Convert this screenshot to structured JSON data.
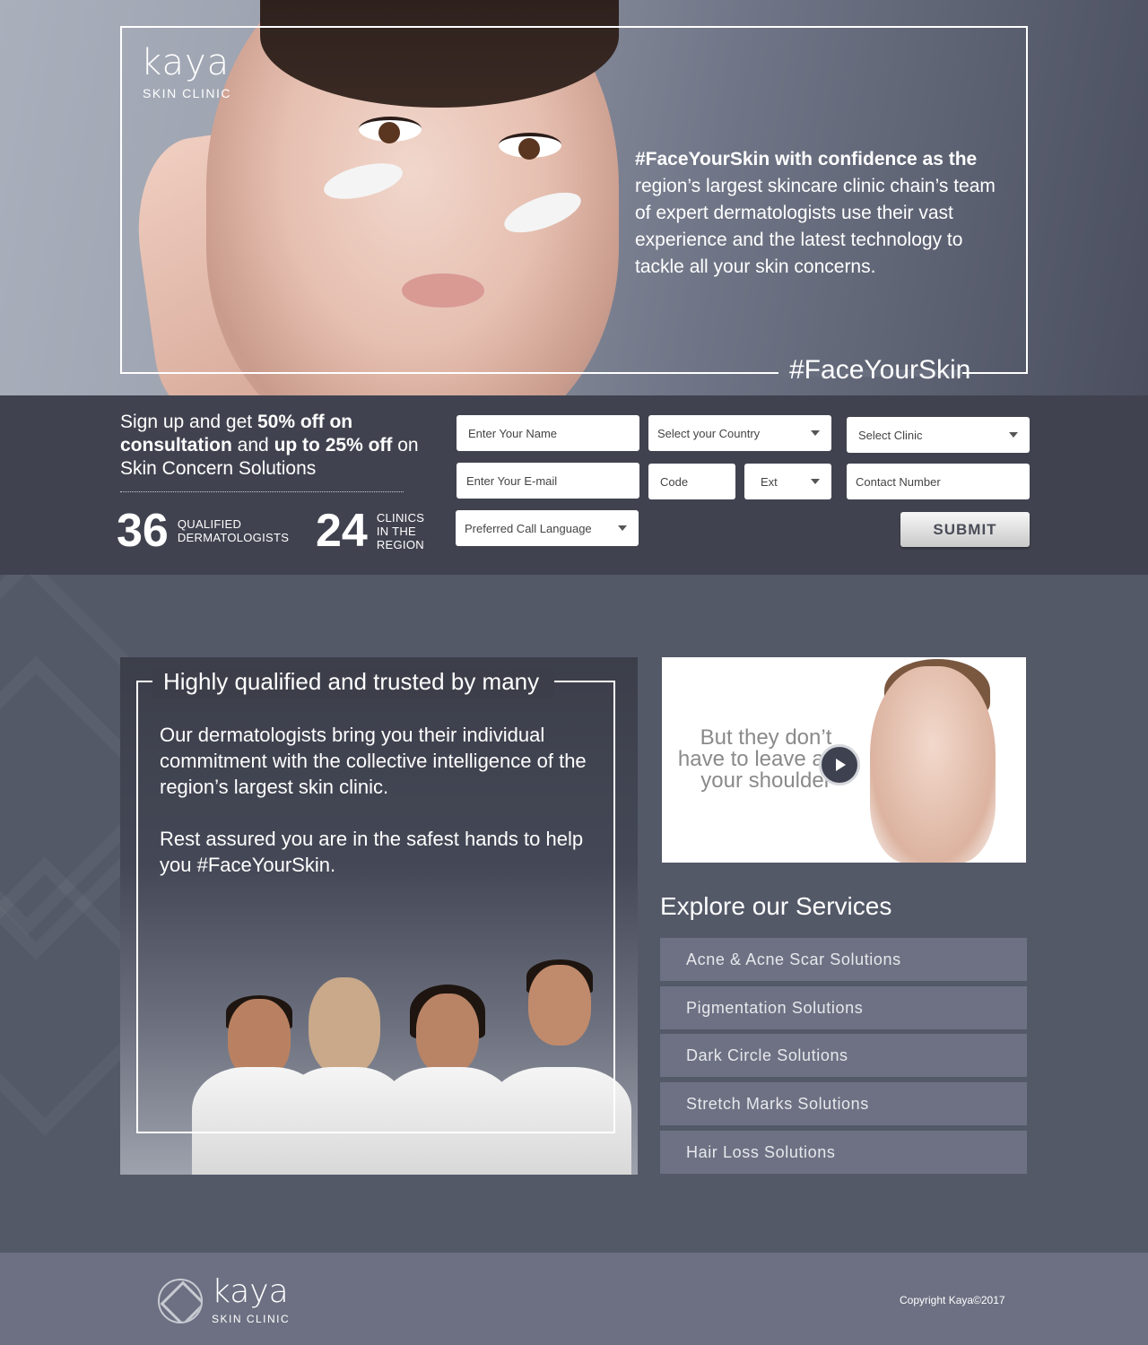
{
  "brand": {
    "name": "kaya",
    "sub": "SKIN CLINIC"
  },
  "hero": {
    "text_bold": "#FaceYourSkin with confidence as the",
    "text_rest": "region’s largest skincare clinic chain’s team of expert dermatologists use their vast experience and the latest technology to tackle all your skin concerns.",
    "hashtag": "#FaceYourSkin"
  },
  "signup": {
    "promo_1": "Sign up and get ",
    "promo_2": "50% off on consultation",
    "promo_3": " and ",
    "promo_4": "up to 25% off",
    "promo_5": " on Skin Concern Solutions",
    "stats": [
      {
        "number": "36",
        "label_1": "QUALIFIED",
        "label_2": "DERMATOLOGISTS"
      },
      {
        "number": "24",
        "label_1": "CLINICS",
        "label_2": "IN THE",
        "label_3": "REGION"
      }
    ],
    "fields": {
      "name": "Enter Your Name",
      "country": "Select your Country",
      "clinic": "Select Clinic",
      "email": "Enter Your E-mail",
      "code": "Code",
      "ext": "Ext",
      "contact": "Contact Number",
      "language": "Preferred Call Language"
    },
    "submit": "SUBMIT"
  },
  "trust": {
    "title": "Highly qualified and trusted by many",
    "p1": "Our dermatologists bring you their individual commitment with the collective intelligence of the region’s largest skin clinic.",
    "p2": "Rest assured you are in the safest hands to help you #FaceYourSkin."
  },
  "video": {
    "caption": "But they don’t have to leave a on your shoulder"
  },
  "services": {
    "title": "Explore our Services",
    "items": [
      "Acne & Acne Scar Solutions",
      "Pigmentation Solutions",
      "Dark Circle Solutions",
      "Stretch Marks Solutions",
      "Hair Loss Solutions"
    ]
  },
  "footer": {
    "copyright": "Copyright Kaya©2017"
  },
  "colors": {
    "band": "#40434f",
    "mid": "#545968",
    "service_item": "#6d7183",
    "footer": "#6c7082"
  }
}
